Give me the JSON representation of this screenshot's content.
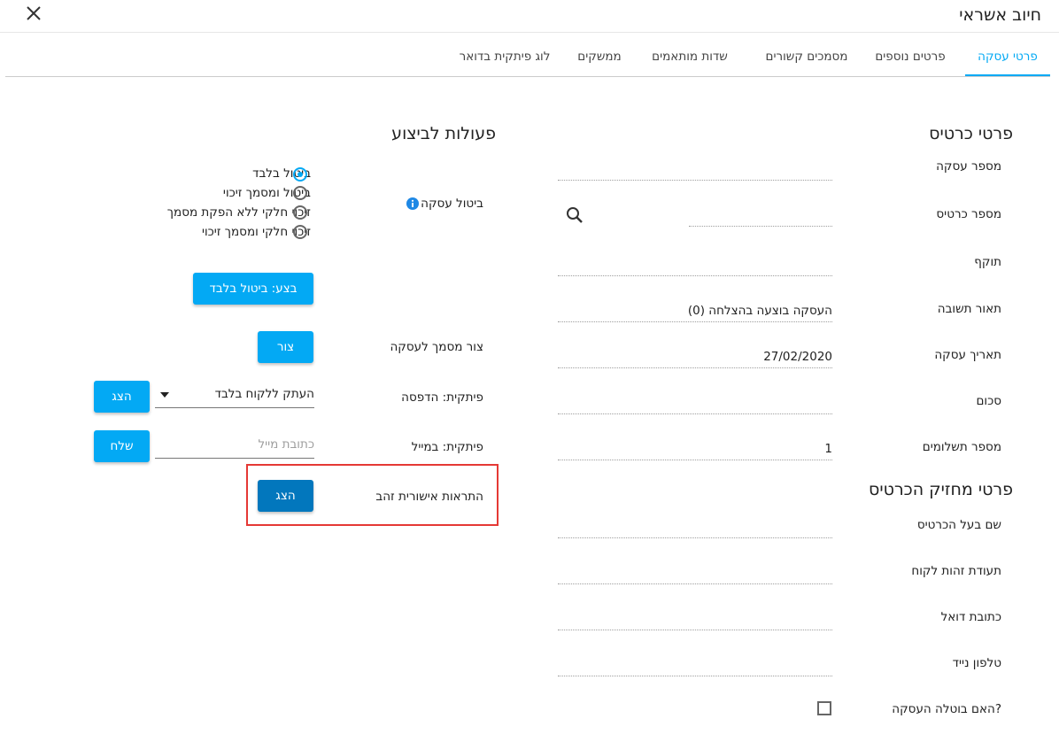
{
  "header": {
    "title": "חיוב אשראי",
    "close_icon": "close-icon"
  },
  "tabs": [
    {
      "label": "פרטי עסקה",
      "active": true
    },
    {
      "label": "פרטים נוספים"
    },
    {
      "label": "מסמכים קשורים"
    },
    {
      "label": "שדות מותאמים"
    },
    {
      "label": "ממשקים"
    },
    {
      "label": "לוג פיתקית בדואר"
    }
  ],
  "card_details": {
    "title": "פרטי כרטיס",
    "fields": [
      {
        "label": "מספר עסקה",
        "value": ""
      },
      {
        "label": "מספר כרטיס",
        "value": ""
      },
      {
        "label": "תוקף",
        "value": ""
      },
      {
        "label": "תאור תשובה",
        "value": "העסקה בוצעה בהצלחה (0)"
      },
      {
        "label": "תאריך עסקה",
        "value": "27/02/2020"
      },
      {
        "label": "סכום",
        "value": ""
      },
      {
        "label": "מספר תשלומים",
        "value": "1"
      }
    ]
  },
  "holder_details": {
    "title": "פרטי מחזיק הכרטיס",
    "fields": [
      {
        "label": "שם בעל הכרטיס",
        "value": ""
      },
      {
        "label": "תעודת זהות לקוח",
        "value": ""
      },
      {
        "label": "כתובת דואל",
        "value": ""
      },
      {
        "label": "טלפון נייד",
        "value": ""
      }
    ],
    "cancelled_label": "האם בוטלה העסקה?"
  },
  "actions": {
    "title": "פעולות לביצוע",
    "cancel_label": "ביטול עסקה",
    "radio_options": [
      "ביטול בלבד",
      "ביטול ומסמך זיכוי",
      "זיכוי חלקי ללא הפקת מסמך",
      "זיכוי חלקי ומסמך זיכוי"
    ],
    "selected_option": 0,
    "execute_button": "בצע: ביטול בלבד",
    "create_doc_label": "צור מסמך לעסקה",
    "create_button": "צור",
    "print_label": "פיתקית: הדפסה",
    "print_select": "העתק ללקוח בלבד",
    "show_button": "הצג",
    "email_label": "פיתקית: במייל",
    "email_placeholder": "כתובת מייל",
    "send_button": "שלח",
    "gold_label": "התראות אישורית זהב",
    "gold_button": "הצג"
  },
  "colors": {
    "accent": "#03a9f4",
    "dark_accent": "#0277bd",
    "highlight": "#e53935"
  }
}
